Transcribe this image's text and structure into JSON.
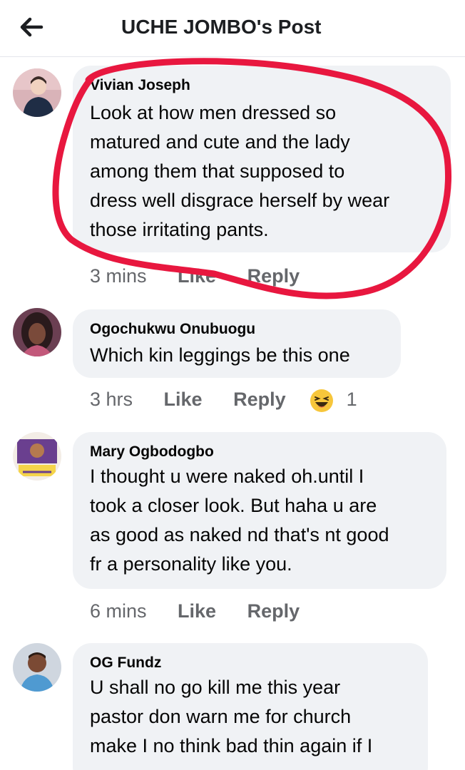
{
  "header": {
    "title": "UCHE JOMBO's Post",
    "back_icon": "arrow-left-icon"
  },
  "comments": [
    {
      "author": "Vivian Joseph",
      "text": "Look at how men dressed so\nmatured and cute and the lady\namong them that supposed to\ndress well disgrace herself by wear\nthose irritating pants.",
      "time": "3 mins",
      "like": "Like",
      "reply": "Reply",
      "annotation_color": "#e8173f"
    },
    {
      "author": "Ogochukwu Onubuogu",
      "text": "Which kin leggings be this one",
      "time": "3 hrs",
      "like": "Like",
      "reply": "Reply",
      "reaction_icon": "haha-emoji-icon",
      "reaction_count": "1"
    },
    {
      "author": "Mary Ogbodogbo",
      "text": "I thought u were naked oh.until I\ntook a closer look. But haha u are\nas good as naked nd that's nt good\nfr a personality like you.",
      "time": "6 mins",
      "like": "Like",
      "reply": "Reply"
    },
    {
      "author": "OG Fundz",
      "text": "U shall no go kill me this year\npastor don warn me for church\nmake I no think bad thin again if I",
      "time": "",
      "like": "",
      "reply": ""
    }
  ],
  "colors": {
    "bubble": "#f0f2f5",
    "secondary_text": "#65676b",
    "annotation": "#e8173f"
  }
}
